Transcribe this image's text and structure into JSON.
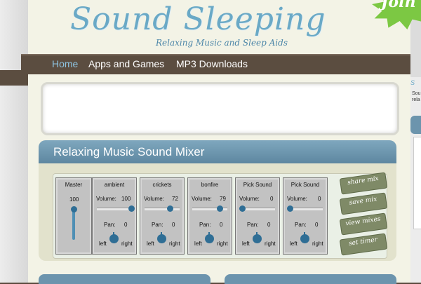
{
  "site": {
    "title": "Sound Sleeping",
    "tagline": "Relaxing Music and Sleep Aids",
    "join_label": "Join"
  },
  "nav": {
    "items": [
      {
        "label": "Home",
        "active": true
      },
      {
        "label": "Apps and Games",
        "active": false
      },
      {
        "label": "MP3 Downloads",
        "active": false
      }
    ]
  },
  "mixer": {
    "title": "Relaxing Music Sound Mixer",
    "master": {
      "name": "Master",
      "value": "100",
      "level": 1.0
    },
    "channels": [
      {
        "name": "ambient",
        "volume_label": "Volume:",
        "volume": "100",
        "volume_level": 1.0,
        "pan_label": "Pan:",
        "pan": "0",
        "left": "left",
        "right": "right"
      },
      {
        "name": "crickets",
        "volume_label": "Volume:",
        "volume": "72",
        "volume_level": 0.72,
        "pan_label": "Pan:",
        "pan": "0",
        "left": "left",
        "right": "right"
      },
      {
        "name": "bonfire",
        "volume_label": "Volume:",
        "volume": "79",
        "volume_level": 0.79,
        "pan_label": "Pan:",
        "pan": "0",
        "left": "left",
        "right": "right"
      },
      {
        "name": "Pick Sound",
        "volume_label": "Volume:",
        "volume": "0",
        "volume_level": 0.0,
        "pan_label": "Pan:",
        "pan": "0",
        "left": "left",
        "right": "right"
      },
      {
        "name": "Pick Sound",
        "volume_label": "Volume:",
        "volume": "0",
        "volume_level": 0.0,
        "pan_label": "Pan:",
        "pan": "0",
        "left": "left",
        "right": "right"
      }
    ],
    "buttons": [
      {
        "label": "share mix"
      },
      {
        "label": "save mix"
      },
      {
        "label": "view mixes"
      },
      {
        "label": "set timer"
      }
    ]
  },
  "right_column": {
    "heading": "S",
    "line1": "Sou",
    "line2": "rela"
  },
  "colors": {
    "accent": "#6aa9c6",
    "nav_bg": "#5b4d40",
    "mixer_header": "#6c94ad",
    "button_green": "#7f8a67",
    "thumb": "#2f6e95"
  }
}
